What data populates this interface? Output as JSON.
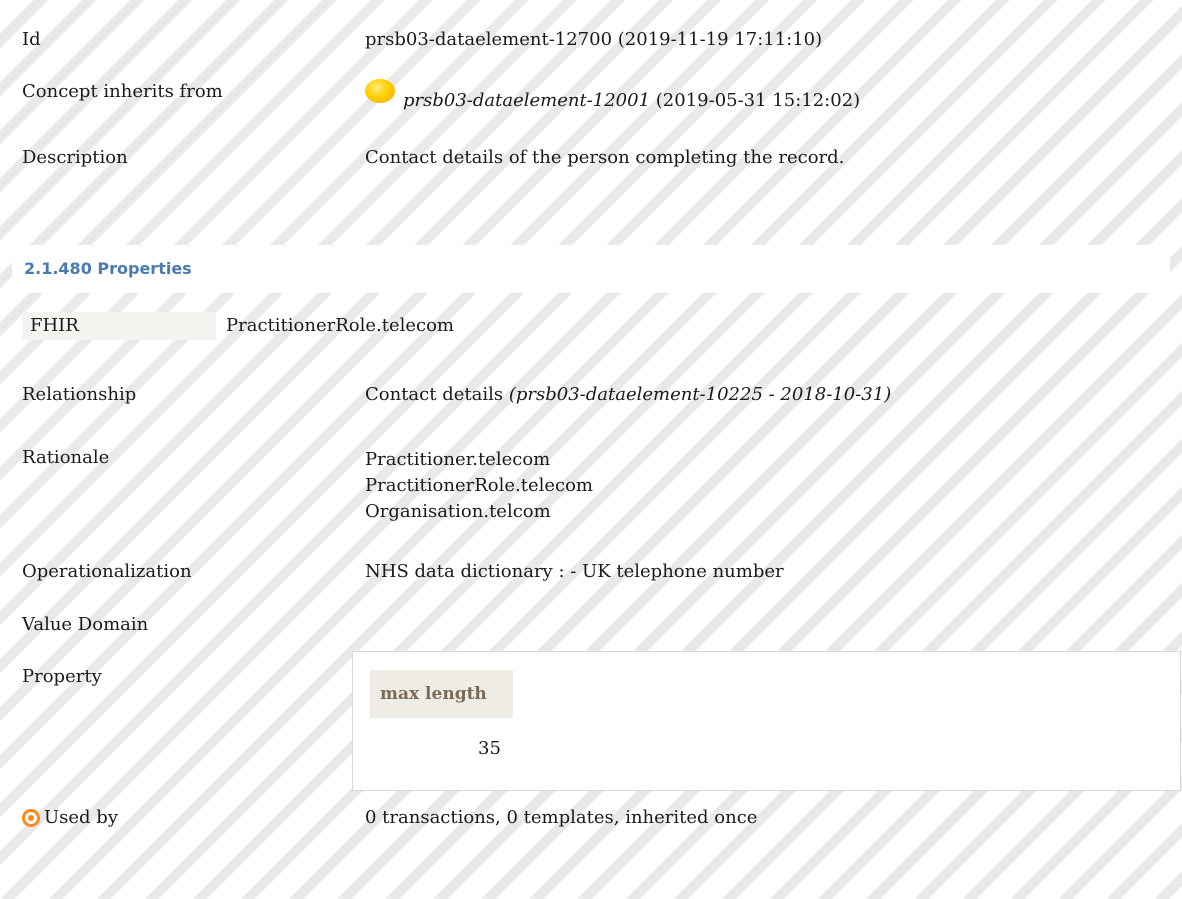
{
  "details": {
    "id_label": "Id",
    "id_value": "prsb03-dataelement-12700 (2019-11-19 17:11:10)",
    "inherits_label": "Concept inherits from",
    "inherits_ref": "prsb03-dataelement-12001",
    "inherits_date": "(2019-05-31 15:12:02)",
    "description_label": "Description",
    "description_value": "Contact details of the person completing the record."
  },
  "section": {
    "title": "2.1.480 Properties"
  },
  "properties": {
    "fhir_label": "FHIR",
    "fhir_value": "PractitionerRole.telecom",
    "relationship_label": "Relationship",
    "relationship_value": "Contact details",
    "relationship_ref": "(prsb03-dataelement-10225 - 2018-10-31)",
    "rationale_label": "Rationale",
    "rationale_lines": [
      "Practitioner.telecom",
      "PractitionerRole.telecom",
      "Organisation.telcom"
    ],
    "operationalization_label": "Operationalization",
    "operationalization_value": "NHS data dictionary : - UK telephone number",
    "value_domain_label": "Value Domain",
    "property_label": "Property",
    "property_header": "max length",
    "property_value": "35",
    "used_by_label": "Used by",
    "used_by_value": "0 transactions, 0 templates, inherited once"
  },
  "icons": {
    "inherits_icon": "yellow-circle-icon",
    "used_by_icon": "target-icon"
  },
  "colors": {
    "section_title": "#4a7bb0",
    "property_header_bg": "#efece6",
    "inherits_dot": "#ffd000",
    "used_by_icon": "#ff8a1a"
  }
}
